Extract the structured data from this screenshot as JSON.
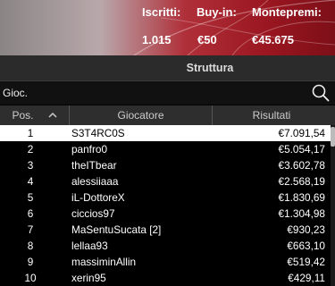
{
  "stats": {
    "iscritti_label": "Iscritti:",
    "iscritti_value": "1.015",
    "buyin_label": "Buy-in:",
    "buyin_value": "€50",
    "montepremi_label": "Montepremi:",
    "montepremi_value": "€45.675"
  },
  "section": {
    "title": "Struttura"
  },
  "search": {
    "label": "Gioc.",
    "icon": "search-icon"
  },
  "table": {
    "headers": {
      "pos": "Pos.",
      "player": "Giocatore",
      "result": "Risultati"
    },
    "sort_icon": "chevron-up-icon",
    "rows": [
      {
        "pos": "1",
        "player": "S3T4RC0S",
        "result": "€7.091,54"
      },
      {
        "pos": "2",
        "player": "panfro0",
        "result": "€5.054,17"
      },
      {
        "pos": "3",
        "player": "theITbear",
        "result": "€3.602,78"
      },
      {
        "pos": "4",
        "player": "alessiiaaa",
        "result": "€2.568,19"
      },
      {
        "pos": "5",
        "player": "iL-DottoreX",
        "result": "€1.830,69"
      },
      {
        "pos": "6",
        "player": "ciccios97",
        "result": "€1.304,98"
      },
      {
        "pos": "7",
        "player": "MaSentuSucata [2]",
        "result": "€930,23"
      },
      {
        "pos": "8",
        "player": "lellaa93",
        "result": "€663,10"
      },
      {
        "pos": "9",
        "player": "massiminAllin",
        "result": "€519,42"
      },
      {
        "pos": "10",
        "player": "xerin95",
        "result": "€429,11"
      }
    ]
  }
}
